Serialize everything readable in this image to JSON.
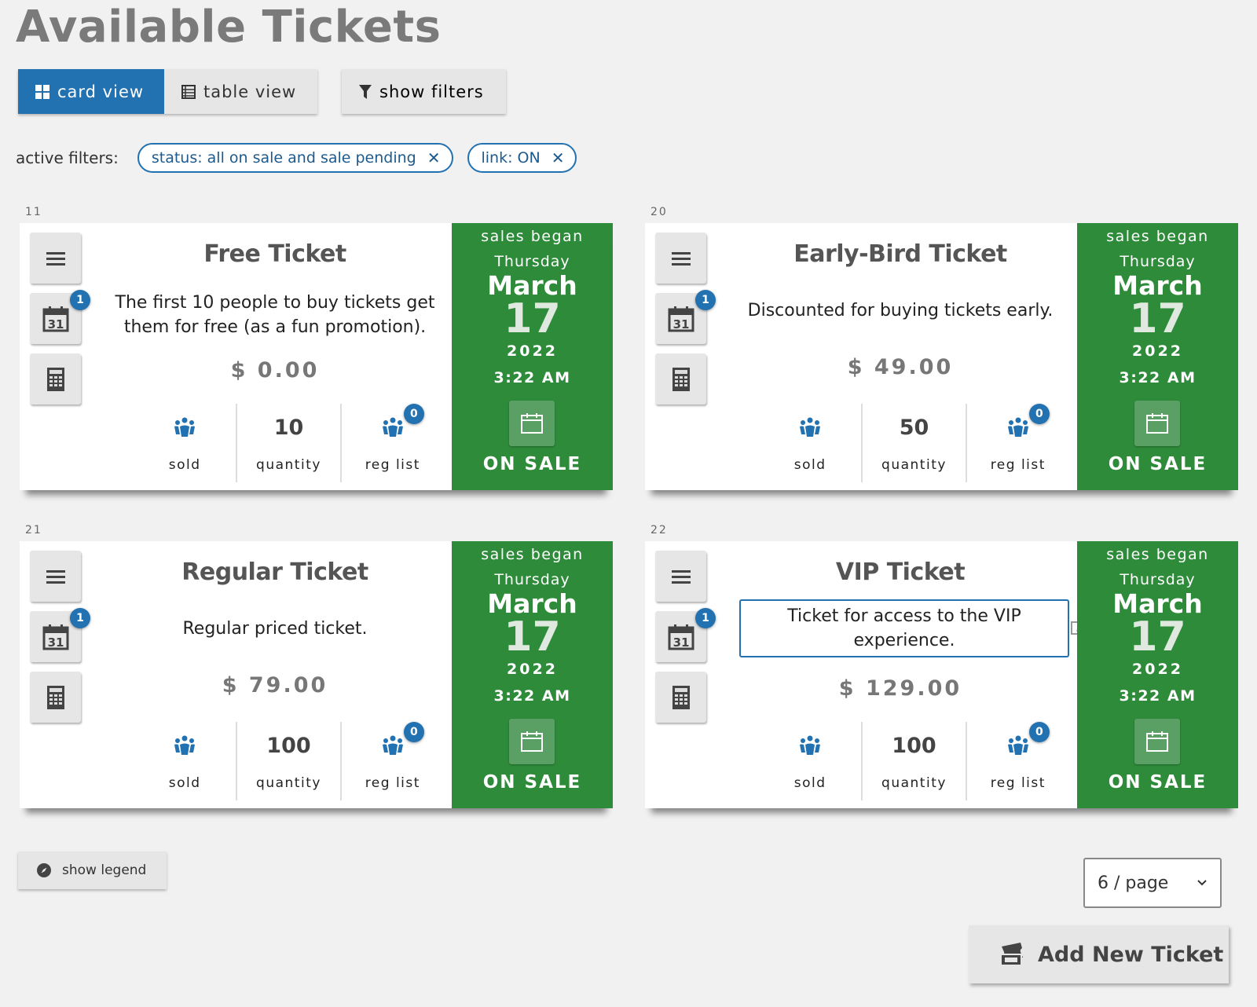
{
  "header": {
    "title": "Available Tickets"
  },
  "toolbar": {
    "card_view_label": "card view",
    "table_view_label": "table view",
    "show_filters_label": "show filters",
    "active_view": "card view"
  },
  "active_filters": {
    "label": "active filters:",
    "chips": [
      {
        "text": "status: all on sale and sale pending"
      },
      {
        "text": "link: ON"
      }
    ]
  },
  "colors": {
    "accent": "#2271b1",
    "on_sale_green": "#2e8b3a",
    "background": "#f1f1f1"
  },
  "tickets": [
    {
      "id": "11",
      "name": "Free Ticket",
      "description": "The first 10 people to buy tickets get them for free (as a fun promotion).",
      "price": "$ 0.00",
      "datetime_badge": "1",
      "sold_label": "sold",
      "quantity": "10",
      "quantity_label": "quantity",
      "reg_list_label": "reg list",
      "reg_list_badge": "0",
      "sales_began_label": "sales began",
      "day": "Thursday",
      "month": "March",
      "date": "17",
      "year": "2022",
      "time": "3:22 AM",
      "status": "ON SALE"
    },
    {
      "id": "20",
      "name": "Early-Bird Ticket",
      "description": "Discounted for buying tickets early.",
      "price": "$ 49.00",
      "datetime_badge": "1",
      "sold_label": "sold",
      "quantity": "50",
      "quantity_label": "quantity",
      "reg_list_label": "reg list",
      "reg_list_badge": "0",
      "sales_began_label": "sales began",
      "day": "Thursday",
      "month": "March",
      "date": "17",
      "year": "2022",
      "time": "3:22 AM",
      "status": "ON SALE"
    },
    {
      "id": "21",
      "name": "Regular Ticket",
      "description": "Regular priced ticket.",
      "price": "$ 79.00",
      "datetime_badge": "1",
      "sold_label": "sold",
      "quantity": "100",
      "quantity_label": "quantity",
      "reg_list_label": "reg list",
      "reg_list_badge": "0",
      "sales_began_label": "sales began",
      "day": "Thursday",
      "month": "March",
      "date": "17",
      "year": "2022",
      "time": "3:22 AM",
      "status": "ON SALE"
    },
    {
      "id": "22",
      "name": "VIP Ticket",
      "description": "Ticket for access to the VIP experience.",
      "price": "$ 129.00",
      "datetime_badge": "1",
      "sold_label": "sold",
      "quantity": "100",
      "quantity_label": "quantity",
      "reg_list_label": "reg list",
      "reg_list_badge": "0",
      "sales_began_label": "sales began",
      "day": "Thursday",
      "month": "March",
      "date": "17",
      "year": "2022",
      "time": "3:22 AM",
      "status": "ON SALE"
    }
  ],
  "footer": {
    "legend_label": "show legend",
    "per_page_value": "6 / page",
    "add_ticket_label": "Add New Ticket"
  }
}
